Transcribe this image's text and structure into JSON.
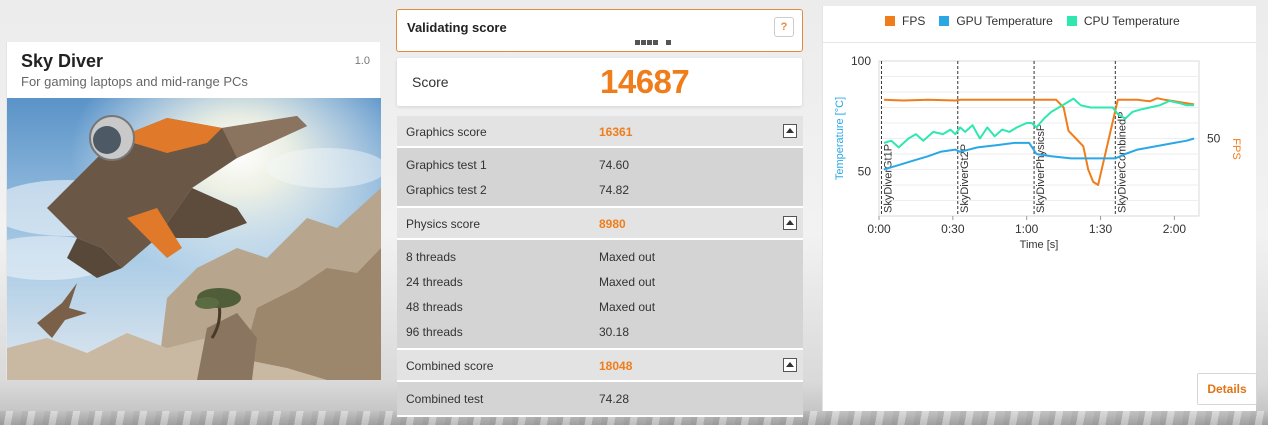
{
  "benchmark": {
    "title": "Sky Diver",
    "version": "1.0",
    "subtitle": "For gaming laptops and mid-range PCs"
  },
  "validation": {
    "label": "Validating score",
    "help_label": "?"
  },
  "score": {
    "label": "Score",
    "value": "14687"
  },
  "sections": [
    {
      "label": "Graphics score",
      "value": "16361",
      "rows": [
        {
          "label": "Graphics test 1",
          "value": "74.60"
        },
        {
          "label": "Graphics test 2",
          "value": "74.82"
        }
      ]
    },
    {
      "label": "Physics score",
      "value": "8980",
      "rows": [
        {
          "label": "8 threads",
          "value": "Maxed out"
        },
        {
          "label": "24 threads",
          "value": "Maxed out"
        },
        {
          "label": "48 threads",
          "value": "Maxed out"
        },
        {
          "label": "96 threads",
          "value": "30.18"
        }
      ]
    },
    {
      "label": "Combined score",
      "value": "18048",
      "rows": [
        {
          "label": "Combined test",
          "value": "74.28"
        }
      ]
    }
  ],
  "colors": {
    "accent": "#f07d1b",
    "fps": "#f07d1b",
    "gpu_temp": "#2aa8e6",
    "cpu_temp": "#2ee8b0"
  },
  "details_label": "Details",
  "chart_data": {
    "type": "line",
    "legend": [
      "FPS",
      "GPU Temperature",
      "CPU Temperature"
    ],
    "legend_position": "top",
    "xlabel": "Time [s]",
    "ylabel_left": "Temperature [°C]",
    "ylabel_right": "FPS",
    "x_ticks": [
      "0:00",
      "0:30",
      "1:00",
      "1:30",
      "2:00"
    ],
    "x_range_s": [
      0,
      130
    ],
    "y_left_ticks": [
      100,
      50
    ],
    "y_left_range": [
      30,
      100
    ],
    "y_right_ticks": [
      50
    ],
    "y_right_range": [
      0,
      100
    ],
    "markers": [
      {
        "label": "SkyDiverGt1P",
        "x": 1
      },
      {
        "label": "SkyDiverGt2P",
        "x": 32
      },
      {
        "label": "SkyDiverPhysicsP",
        "x": 63
      },
      {
        "label": "SkyDiverCombinedP",
        "x": 96
      }
    ],
    "series": [
      {
        "name": "FPS",
        "axis": "right",
        "points": [
          [
            2,
            75
          ],
          [
            10,
            74.5
          ],
          [
            20,
            75
          ],
          [
            31,
            74.5
          ],
          [
            33,
            75
          ],
          [
            45,
            75
          ],
          [
            55,
            75
          ],
          [
            61,
            75
          ],
          [
            64,
            75
          ],
          [
            72,
            75
          ],
          [
            75,
            70
          ],
          [
            77,
            55
          ],
          [
            80,
            50
          ],
          [
            83,
            45
          ],
          [
            85,
            30
          ],
          [
            87,
            22
          ],
          [
            89,
            20
          ],
          [
            97,
            75
          ],
          [
            105,
            75
          ],
          [
            110,
            74
          ],
          [
            113,
            76
          ],
          [
            116,
            75
          ],
          [
            120,
            74
          ],
          [
            124,
            73
          ],
          [
            128,
            72
          ]
        ]
      },
      {
        "name": "GPU Temperature",
        "axis": "left",
        "points": [
          [
            2,
            51
          ],
          [
            8,
            53
          ],
          [
            14,
            55
          ],
          [
            20,
            57
          ],
          [
            25,
            59
          ],
          [
            31,
            60
          ],
          [
            33,
            59
          ],
          [
            40,
            61
          ],
          [
            48,
            62
          ],
          [
            55,
            63
          ],
          [
            61,
            63
          ],
          [
            64,
            58
          ],
          [
            70,
            57
          ],
          [
            78,
            56
          ],
          [
            86,
            56
          ],
          [
            90,
            56
          ],
          [
            96,
            56
          ],
          [
            100,
            58
          ],
          [
            105,
            60
          ],
          [
            110,
            61
          ],
          [
            115,
            62
          ],
          [
            120,
            63
          ],
          [
            125,
            64
          ],
          [
            128,
            65
          ]
        ]
      },
      {
        "name": "CPU Temperature",
        "axis": "left",
        "points": [
          [
            2,
            63
          ],
          [
            5,
            64
          ],
          [
            8,
            61
          ],
          [
            12,
            65
          ],
          [
            15,
            67
          ],
          [
            18,
            64
          ],
          [
            22,
            68
          ],
          [
            26,
            67
          ],
          [
            29,
            69
          ],
          [
            31,
            67
          ],
          [
            33,
            70
          ],
          [
            35,
            68
          ],
          [
            38,
            71
          ],
          [
            41,
            65
          ],
          [
            44,
            70
          ],
          [
            47,
            66
          ],
          [
            50,
            69
          ],
          [
            53,
            68
          ],
          [
            56,
            70
          ],
          [
            60,
            72
          ],
          [
            62,
            72
          ],
          [
            64,
            70
          ],
          [
            67,
            74
          ],
          [
            70,
            77
          ],
          [
            73,
            79
          ],
          [
            76,
            81
          ],
          [
            79,
            83
          ],
          [
            82,
            80
          ],
          [
            86,
            79
          ],
          [
            90,
            79
          ],
          [
            95,
            79
          ],
          [
            97,
            76
          ],
          [
            100,
            74
          ],
          [
            103,
            77
          ],
          [
            106,
            78
          ],
          [
            110,
            79
          ],
          [
            114,
            80
          ],
          [
            118,
            82
          ],
          [
            122,
            81
          ],
          [
            125,
            80
          ],
          [
            128,
            80
          ]
        ]
      }
    ]
  }
}
